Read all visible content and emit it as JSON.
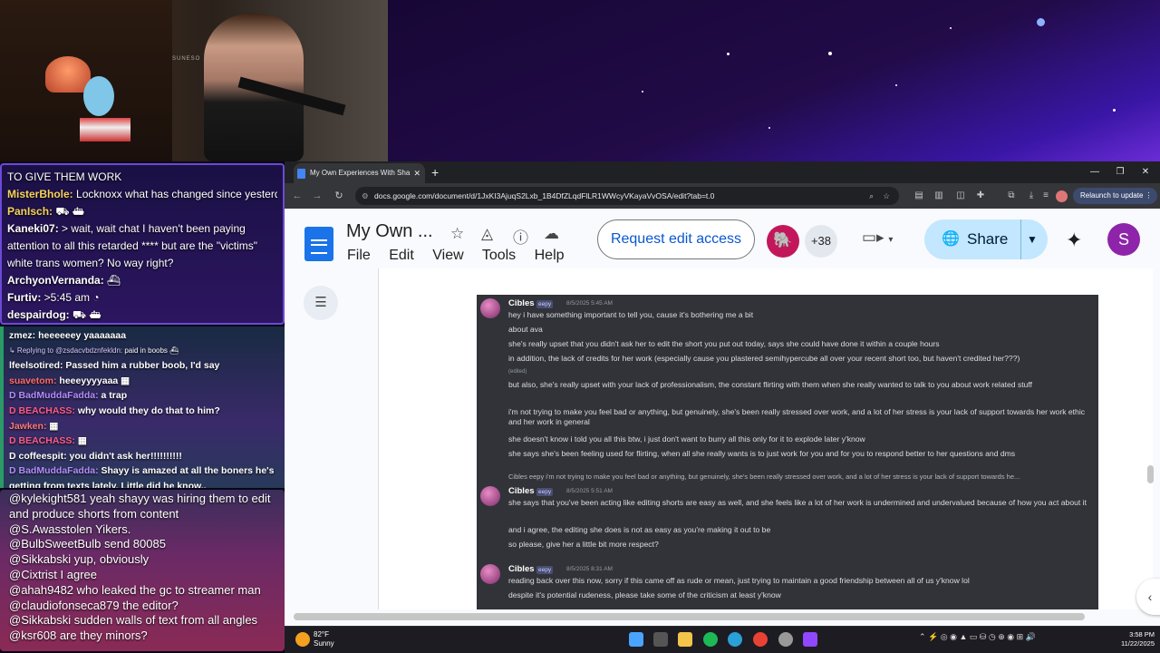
{
  "stream": {
    "webcam_sign": "SUNESO",
    "chat_top": [
      {
        "name": "",
        "text": "TO GIVE THEM WORK",
        "color": "#ffffff"
      },
      {
        "name": "MisterBhole:",
        "text": " Locknoxx what has changed since yesterday",
        "color": "#f7d25b"
      },
      {
        "name": "PanIsch:",
        "text": " ⛟ ⛴",
        "color": "#f7d25b"
      },
      {
        "name": "Kaneki07:",
        "text": " > wait, wait chat I haven't been paying attention to all this retarded **** but are the \"victims\" white trans women? No way right?",
        "color": "#ffffff"
      },
      {
        "name": "ArchyonVernanda:",
        "text": " ⛴",
        "color": "#ffffff"
      },
      {
        "name": "Furtiv:",
        "text": " >5:45 am ◔",
        "color": "#ffffff"
      },
      {
        "name": "despairdog:",
        "text": " ⛟ ⛴",
        "color": "#ffffff"
      }
    ],
    "chat_mid": [
      {
        "name": "zmez:",
        "text": " heeeeeey yaaaaaaa",
        "color": "#ffffff"
      },
      {
        "name": "↳ Replying to @zsdacvbdznfekldn:",
        "text": " paid in boobs ⛴",
        "color": "#d9c9ff"
      },
      {
        "name": "lfeelsotired:",
        "text": " Passed him a rubber boob, I'd say",
        "color": "#ffffff"
      },
      {
        "name": "suavetom:",
        "text": " heeeyyyyaaa ▦",
        "color": "#ff6b6b"
      },
      {
        "name": "D BadMuddaFadda:",
        "text": " a trap",
        "color": "#b48cff"
      },
      {
        "name": "D BEACHASS:",
        "text": " why would they do that to him?",
        "color": "#ff5a8a"
      },
      {
        "name": "Jawken:",
        "text": " ▦",
        "color": "#ff7a7a"
      },
      {
        "name": "D BEACHASS:",
        "text": " ▦",
        "color": "#ff5a8a"
      },
      {
        "name": "D coffeespit:",
        "text": " you didn't ask her!!!!!!!!!!",
        "color": "#ffffff"
      },
      {
        "name": "D BadMuddaFadda:",
        "text": " Shayy is amazed at all the boners he's",
        "color": "#b48cff"
      },
      {
        "name": "",
        "text": "getting from texts lately. Little did he know..",
        "color": "#ffffff"
      }
    ],
    "chat_bottom": [
      {
        "name": "@kylekight581",
        "text": " yeah shayy was hiring them to edit and produce shorts from content"
      },
      {
        "name": "@S.Awasstolen",
        "text": " Yikers."
      },
      {
        "name": "@BulbSweetBulb",
        "text": " send 80085"
      },
      {
        "name": "@Sikkabski",
        "text": " yup, obviously"
      },
      {
        "name": "@Cixtrist",
        "text": " I agree"
      },
      {
        "name": "@ahah9482",
        "text": " who leaked the gc to streamer man"
      },
      {
        "name": "@claudiofonseca879",
        "text": " the editor?"
      },
      {
        "name": "@Sikkabski",
        "text": " sudden walls of text from all angles"
      },
      {
        "name": "@ksr608",
        "text": " are they minors?"
      }
    ]
  },
  "browser": {
    "tab_title": "My Own Experiences With Sha",
    "url": "docs.google.com/document/d/1JxKI3AjuqS2Lxb_1B4DfZLqdFlLR1WWcyVKayaVvOSA/edit?tab=t.0",
    "relaunch": "Relaunch to update"
  },
  "docs": {
    "title": "My Own ...",
    "menu": [
      "File",
      "Edit",
      "View",
      "Tools",
      "Help"
    ],
    "request_edit": "Request edit access",
    "collaborators_more": "+38",
    "share": "Share",
    "user_initial": "S"
  },
  "discord": {
    "messages": [
      {
        "author": "Cibles",
        "tag": "eepy",
        "time": "8/5/2025 5:45 AM",
        "lines": [
          "hey i have something important to tell you, cause it's bothering me a bit",
          "about ava",
          "she's really upset that you didn't ask her to edit the short you put out today, says she could have done it within a couple hours",
          "in addition, the lack of credits for her work (especially cause you plastered semihypercube all over your recent short too, but haven't credited her???)",
          "but also, she's really upset with your lack of professionalism, the constant flirting with them when she really wanted to talk to you about work related stuff",
          "i'm not trying to make you feel bad or anything, but genuinely, she's been really stressed over work, and a lot of her stress is your lack of support towards her work ethic and her work in general",
          "she doesn't know i told you all this btw, i just don't want to burry all this only for it to explode later y'know",
          "she says she's been feeling used for flirting, when all she really wants is to just work for you and for you to respond better to her questions and dms"
        ]
      },
      {
        "author": "Cibles",
        "tag": "eepy",
        "time": "8/5/2025 5:51 AM",
        "reply": "Cibles  eepy  i'm not trying to make you feel bad or anything, but genuinely, she's been really stressed over work, and a lot of her stress is your lack of support towards he...",
        "lines": [
          "she says that you've been acting like editing shorts are easy as well, and she feels like a lot of her work is undermined and undervalued because of how you act about it",
          "and i agree, the editing she does is not as easy as you're making it out to be",
          "so please, give her a little bit more respect?"
        ]
      },
      {
        "author": "Cibles",
        "tag": "eepy",
        "time": "8/5/2025 8:31 AM",
        "lines": [
          "reading back over this now, sorry if this came off as rude or mean, just trying to maintain a good friendship between all of us y'know lol",
          "despite it's potential rudeness, please take some of the criticism at least y'know"
        ]
      }
    ],
    "edited_label": "(edited)"
  },
  "taskbar": {
    "temp": "82°F",
    "condition": "Sunny",
    "time": "3:58 PM",
    "date": "11/22/2025"
  }
}
